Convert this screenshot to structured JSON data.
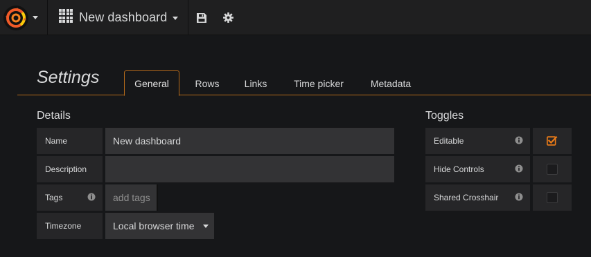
{
  "navbar": {
    "dashboard_title": "New dashboard",
    "icons": [
      "grafana-logo-icon",
      "grid-icon",
      "save-icon",
      "gear-icon"
    ]
  },
  "settings": {
    "title": "Settings",
    "tabs": [
      {
        "label": "General",
        "active": true
      },
      {
        "label": "Rows",
        "active": false
      },
      {
        "label": "Links",
        "active": false
      },
      {
        "label": "Time picker",
        "active": false
      },
      {
        "label": "Metadata",
        "active": false
      }
    ]
  },
  "details": {
    "title": "Details",
    "name_label": "Name",
    "name_value": "New dashboard",
    "description_label": "Description",
    "description_value": "",
    "tags_label": "Tags",
    "tags_placeholder": "add tags",
    "timezone_label": "Timezone",
    "timezone_value": "Local browser time"
  },
  "toggles": {
    "title": "Toggles",
    "items": [
      {
        "label": "Editable",
        "checked": true
      },
      {
        "label": "Hide Controls",
        "checked": false
      },
      {
        "label": "Shared Crosshair",
        "checked": false
      }
    ]
  },
  "colors": {
    "accent": "#eb7b18",
    "tab_border": "#b86c1a",
    "background": "#161719",
    "navbar": "#1f1f20"
  }
}
